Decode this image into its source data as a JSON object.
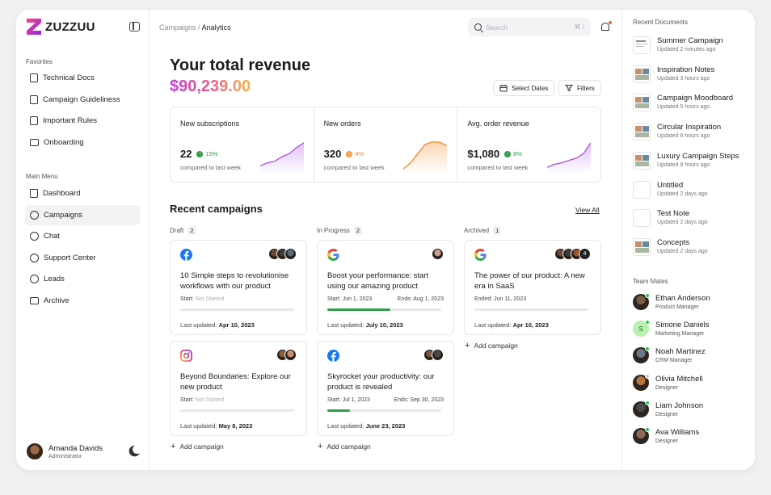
{
  "brand": {
    "name": "ZUZZUU"
  },
  "sidebar": {
    "favorites_title": "Favorites",
    "favorites": [
      {
        "label": "Technical Docs",
        "icon": "document-icon"
      },
      {
        "label": "Campaign Guideliness",
        "icon": "document-icon"
      },
      {
        "label": "Important Rules",
        "icon": "document-icon"
      },
      {
        "label": "Onboarding",
        "icon": "video-icon"
      }
    ],
    "menu_title": "Main Menu",
    "menu": [
      {
        "label": "Dashboard",
        "icon": "home-icon"
      },
      {
        "label": "Campaigns",
        "icon": "campaign-icon",
        "active": true
      },
      {
        "label": "Chat",
        "icon": "chat-icon"
      },
      {
        "label": "Support Center",
        "icon": "support-icon"
      },
      {
        "label": "Leads",
        "icon": "dollar-icon"
      },
      {
        "label": "Archive",
        "icon": "folder-icon"
      }
    ],
    "user": {
      "name": "Amanda Davids",
      "role": "Administrator"
    }
  },
  "header": {
    "breadcrumb_parent": "Campaigns",
    "breadcrumb_sep": "/",
    "breadcrumb_current": "Analytics",
    "search_placeholder": "Search",
    "search_shortcut": "⌘ /"
  },
  "revenue": {
    "title": "Your total revenue",
    "amount": "$90,239.00",
    "select_dates": "Select Dates",
    "filters": "Filters"
  },
  "stats": [
    {
      "label": "New subscriptions",
      "value": "22",
      "delta": "15%",
      "direction": "up",
      "sub": "compared to last week",
      "color": "#a34ee0",
      "trend": [
        2,
        3,
        3.5,
        5,
        6,
        8,
        9.5
      ]
    },
    {
      "label": "New orders",
      "value": "320",
      "delta": "4%",
      "direction": "down",
      "sub": "compared to last week",
      "color": "#f08a2a",
      "trend": [
        1,
        3,
        6,
        9,
        9.8,
        9.7,
        8.6
      ]
    },
    {
      "label": "Avg. order revenue",
      "value": "$1,080",
      "delta": "8%",
      "direction": "up",
      "sub": "compared to last week",
      "color": "#a34ee0",
      "trend": [
        1.5,
        2.5,
        3,
        3.8,
        4.5,
        6,
        9.5
      ]
    }
  ],
  "campaigns": {
    "title": "Recent campaigns",
    "view_all": "View All",
    "add_label": "Add campaign",
    "columns": [
      {
        "name": "Draft",
        "count": "2",
        "cards": [
          {
            "logo": "facebook-icon",
            "title": "10 Simple steps to revolutionise workflows with our product",
            "start_label": "Start:",
            "start": "Not Started",
            "end_label": "",
            "end": "",
            "progress": 0,
            "updated_label": "Last updated:",
            "updated": "Apr 10, 2023",
            "avatars": [
              "#6b4a36",
              "#3d3d3d",
              "#5a6b7d"
            ],
            "more": ""
          },
          {
            "logo": "instagram-icon",
            "title": "Beyond Boundaries: Explore our new product",
            "start_label": "Start:",
            "start": "Not Started",
            "end_label": "",
            "end": "",
            "progress": 0,
            "updated_label": "Last updated:",
            "updated": "May 8, 2023",
            "avatars": [
              "#8a5a3c",
              "#c98f6a"
            ],
            "more": ""
          }
        ]
      },
      {
        "name": "In Progress",
        "count": "2",
        "cards": [
          {
            "logo": "google-icon",
            "title": "Boost your performance: start using our amazing product",
            "start_label": "Start:",
            "start": "Jun 1, 2023",
            "end_label": "Ends:",
            "end": "Aug 1, 2023",
            "progress": 0.55,
            "updated_label": "Last updated:",
            "updated": "July 10, 2023",
            "avatars": [
              "#c9a08a"
            ],
            "more": ""
          },
          {
            "logo": "facebook-icon",
            "title": "Skyrocket your productivity: our product is revealed",
            "start_label": "Start:",
            "start": "Jul 1, 2023",
            "end_label": "Ends:",
            "end": "Sep 30, 2023",
            "progress": 0.2,
            "updated_label": "Last updated:",
            "updated": "June 23, 2023",
            "avatars": [
              "#7b5a45",
              "#4a4a4a"
            ],
            "more": ""
          }
        ]
      },
      {
        "name": "Archived",
        "count": "1",
        "cards": [
          {
            "logo": "google-icon",
            "title": "The power of our product: A new era in SaaS",
            "start_label": "Ended:",
            "start": "Jun 11, 2023",
            "end_label": "",
            "end": "",
            "progress": 0,
            "updated_label": "Last updated:",
            "updated": "Apr 10, 2023",
            "avatars": [
              "#6b4a36",
              "#3d3d3d",
              "#a0522d"
            ],
            "more": "4"
          }
        ]
      }
    ]
  },
  "right": {
    "docs_title": "Recent Documents",
    "docs": [
      {
        "name": "Summer Campaign",
        "time": "Updated 2 minutes ago",
        "thumb": "text-doc"
      },
      {
        "name": "Inspiration Notes",
        "time": "Updated 3 hours ago",
        "thumb": "photo-doc"
      },
      {
        "name": "Campaign Moodboard",
        "time": "Updated 5 hours ago",
        "thumb": "photo-doc"
      },
      {
        "name": "Circular Inspiration",
        "time": "Updated 8 hours ago",
        "thumb": "photo-doc"
      },
      {
        "name": "Luxury Campaign Steps",
        "time": "Updated 8 hours ago",
        "thumb": "photo-doc"
      },
      {
        "name": "Untitled",
        "time": "Updated 2 days ago",
        "thumb": "blank-doc"
      },
      {
        "name": "Test Note",
        "time": "Updated 2 days ago",
        "thumb": "blank-doc"
      },
      {
        "name": "Concepts",
        "time": "Updated 2 days ago",
        "thumb": "photo-doc"
      }
    ],
    "team_title": "Team Mates",
    "team": [
      {
        "name": "Ethan Anderson",
        "role": "Product Manager",
        "online": true,
        "color": "#7a5a44"
      },
      {
        "name": "Simone Daniels",
        "role": "Marketing Manager",
        "online": true,
        "initial": "S",
        "color": "#b8f0b0"
      },
      {
        "name": "Noah Martinez",
        "role": "CRM Manager",
        "online": true,
        "color": "#6b7785"
      },
      {
        "name": "Olivia Mitchell",
        "role": "Designer",
        "online": false,
        "color": "#b9733e"
      },
      {
        "name": "Liam Johnson",
        "role": "Designer",
        "online": true,
        "color": "#4a4a4a"
      },
      {
        "name": "Ava Williams",
        "role": "Designer",
        "online": true,
        "color": "#8b6a55"
      }
    ]
  }
}
